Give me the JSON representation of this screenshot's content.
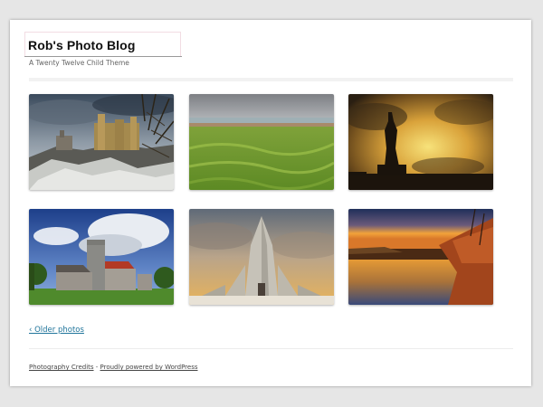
{
  "header": {
    "site_title": "Rob's Photo Blog",
    "tagline": "A Twenty Twelve Child Theme"
  },
  "gallery": {
    "photos": [
      {
        "name": "castle-on-rocky-hill"
      },
      {
        "name": "green-meadow-coast"
      },
      {
        "name": "statue-at-sunset"
      },
      {
        "name": "stone-church"
      },
      {
        "name": "hallgrimskirkja-church"
      },
      {
        "name": "river-at-sunset"
      }
    ]
  },
  "navigation": {
    "older_label": "‹ Older photos"
  },
  "footer": {
    "credits_label": "Photography Credits",
    "separator": " - ",
    "powered_label": "Proudly powered by WordPress"
  },
  "colors": {
    "link": "#21759b",
    "background": "#e6e6e6",
    "page": "#ffffff"
  }
}
